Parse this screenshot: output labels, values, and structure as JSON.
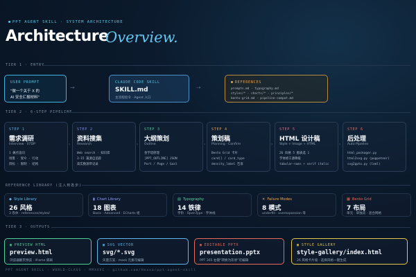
{
  "header": {
    "kicker": "PPT AGENT SKILL · SYSTEM ARCHITECTURE",
    "title": "Architecture",
    "title_italic": "Overview."
  },
  "tier1": {
    "label": "TIER 1 · ENTRY",
    "user_prompt": {
      "label": "USER PROMPT",
      "line1": "\"做一个关于 X 的",
      "line2": "AI 安全汇报材料\""
    },
    "skill": {
      "label": "CLAUDE CODE SKILL",
      "main": "SKILL.md",
      "sub": "主流程指令 · Agent 入口"
    },
    "references": {
      "label": "REFERENCES",
      "lines": [
        "prompts.md · typography.md",
        "styles/* · charts/* · principles/*",
        "bento-grid.md · pipeline-compat.md"
      ]
    }
  },
  "tier2": {
    "label": "TIER 2 · 6-STEP PIPELINE",
    "steps": [
      {
        "num": "STEP 1",
        "title": "需求调研",
        "sub": "Interview · 07DP",
        "lines": [
          "1 痛点追问",
          "场景 · 受众 · 行动",
          "目标 · 限制 · 结构"
        ],
        "color": "#4fb6e8"
      },
      {
        "num": "STEP 2",
        "title": "资料搜集",
        "sub": "Research",
        "lines": [
          "Web search · 知识库",
          "3-15 篇源自追踪",
          "高实数源带记录"
        ],
        "color": "#7d8cf2"
      },
      {
        "num": "STEP 3",
        "title": "大纲策划",
        "sub": "Outline",
        "lines": [
          "金字塔原理",
          "[PPT_OUTLINE] JSON",
          "Part / Page / Goal"
        ],
        "color": "#4fd19a"
      },
      {
        "num": "STEP 4",
        "title": "策划稿",
        "sub": "Planning · Confirm",
        "lines": [
          "Bento Grid 卡片",
          "card[] / card_type",
          "density_label 告诉"
        ],
        "color": "#f0a44a"
      },
      {
        "num": "STEP 5",
        "title": "HTML 设计稿",
        "sub": "Style + Image + HTML",
        "lines": [
          "26 风格 5 图表选 1",
          "字体修工源降级",
          "tabular-nums + serif italic"
        ],
        "color": "#e8688a"
      },
      {
        "num": "STEP 6",
        "title": "后处理",
        "sub": "Auto Pipeline",
        "lines": [
          "html_packager.py",
          "html2svg.py (puppeteer)",
          "svg2pptx.py (lxml)"
        ],
        "color": "#e86a5a"
      }
    ]
  },
  "library": {
    "label": "REFERENCE LIBRARY (注入到各步)",
    "items": [
      {
        "icon": "◆",
        "label": "Style Library",
        "title": "26 风格",
        "sub": "3 卷体 · references/styles/",
        "color": "#5fb8f0"
      },
      {
        "icon": "▮",
        "label": "Chart Library",
        "title": "18 图表",
        "sub": "Basic · Advanced · ECharts 组",
        "color": "#8f9cf5"
      },
      {
        "icon": "▤",
        "label": "Typography",
        "title": "14 铁律",
        "sub": "字阶 · OpenType · 字体线",
        "color": "#5fd0a5"
      },
      {
        "icon": "✕",
        "label": "Failure Modes",
        "title": "8 模式",
        "sub": "underfill · overexpansion 等",
        "color": "#f0a44a"
      },
      {
        "icon": "▦",
        "label": "Bento Grid",
        "title": "7 布局",
        "sub": "单元 · 单独双 · 混合网格",
        "color": "#e86a5a"
      }
    ]
  },
  "tier3": {
    "label": "TIER 3 · OUTPUTS",
    "outputs": [
      {
        "label": "PREVIEW HTML",
        "main": "preview.html",
        "sub": "浏览器翻页预览 · iframe 隔离",
        "color": "#4fd19a"
      },
      {
        "label": "SVG VECTOR",
        "main": "svg/*.svg",
        "sub": "矢量方案 · mask 元素可编辑",
        "color": "#5fb8f0"
      },
      {
        "label": "EDITABLE PPTX",
        "main": "presentation.pptx",
        "sub": "PPT 365 右键\"转换为形状\"可编辑",
        "color": "#e86a5a"
      },
      {
        "label": "STYLE GALLERY",
        "main": "style-gallery/index.html",
        "sub": "26 风格卡片墙 · 选择风格一键生成",
        "color": "#e8c84a"
      }
    ]
  },
  "footer": {
    "text": "PPT AGENT SKILL · WORLD-CLASS · MMXXVI · github.com/Hexxa/ppt-agent-skill"
  },
  "colors": {
    "accent_cyan": "#59c9e6",
    "accent_amber": "#f0a44a",
    "bg": "#07111e"
  }
}
